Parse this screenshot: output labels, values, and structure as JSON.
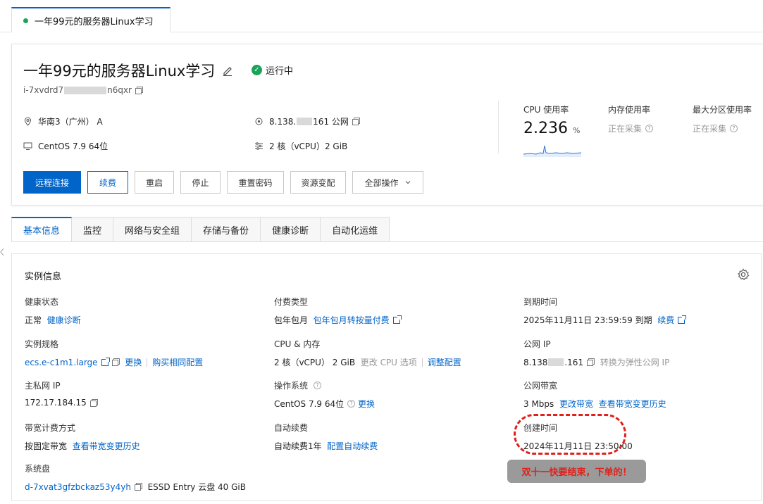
{
  "top_tab": {
    "label": "一年99元的服务器Linux学习"
  },
  "summary": {
    "title": "一年99元的服务器Linux学习",
    "status": "运行中",
    "instance_id_prefix": "i-7xvdrd7",
    "instance_id_suffix": "n6qxr",
    "region": "华南3（广州） A",
    "os": "CentOS 7.9 64位",
    "ip_prefix": "8.138.",
    "ip_suffix": "161 公网",
    "spec": "2 核（vCPU）2 GiB",
    "buttons": [
      "远程连接",
      "续费",
      "重启",
      "停止",
      "重置密码",
      "资源变配",
      "全部操作"
    ],
    "metrics": {
      "cpu_label": "CPU 使用率",
      "cpu_value": "2.236",
      "cpu_unit": "%",
      "mem_label": "内存使用率",
      "disk_label": "最大分区使用率",
      "collecting": "正在采集"
    }
  },
  "tabs": [
    "基本信息",
    "监控",
    "网络与安全组",
    "存储与备份",
    "健康诊断",
    "自动化运维"
  ],
  "detail": {
    "heading": "实例信息",
    "health": {
      "label": "健康状态",
      "value": "正常",
      "link": "健康诊断"
    },
    "billing": {
      "label": "付费类型",
      "value": "包年包月",
      "link": "包年包月转按量付费"
    },
    "expire": {
      "label": "到期时间",
      "value": "2025年11月11日 23:59:59  到期",
      "link": "续费"
    },
    "spec": {
      "label": "实例规格",
      "value": "ecs.e-c1m1.large",
      "link1": "更换",
      "link2": "购买相同配置"
    },
    "cpu_mem": {
      "label": "CPU & 内存",
      "v1": "2 核（vCPU）",
      "v2": "2 GiB",
      "muted": "更改 CPU 选项",
      "link": "调整配置"
    },
    "public_ip": {
      "label": "公网 IP",
      "prefix": "8.138",
      "suffix": ".161",
      "muted": "转换为弹性公网 IP"
    },
    "private_ip": {
      "label": "主私网 IP",
      "value": "172.17.184.15"
    },
    "os": {
      "label": "操作系统",
      "value": "CentOS 7.9 64位",
      "link": "更换"
    },
    "bandwidth": {
      "label": "公网带宽",
      "value": "3 Mbps",
      "link1": "更改带宽",
      "link2": "查看带宽变更历史"
    },
    "bw_billing": {
      "label": "带宽计费方式",
      "value": "按固定带宽",
      "link": "查看带宽变更历史"
    },
    "auto_renew": {
      "label": "自动续费",
      "value": "自动续费1年",
      "link": "配置自动续费"
    },
    "created": {
      "label": "创建时间",
      "value": "2024年11月11日 23:50:00"
    },
    "disk": {
      "label": "系统盘",
      "value": "d-7xvat3gfzbckaz53y4yh",
      "extra": "ESSD Entry 云盘  40 GiB"
    }
  },
  "annotation": "双十一快要结束，下单的！",
  "colors": {
    "accent": "#0064c8",
    "running": "#1aa35a",
    "annotation": "#e0201a"
  }
}
